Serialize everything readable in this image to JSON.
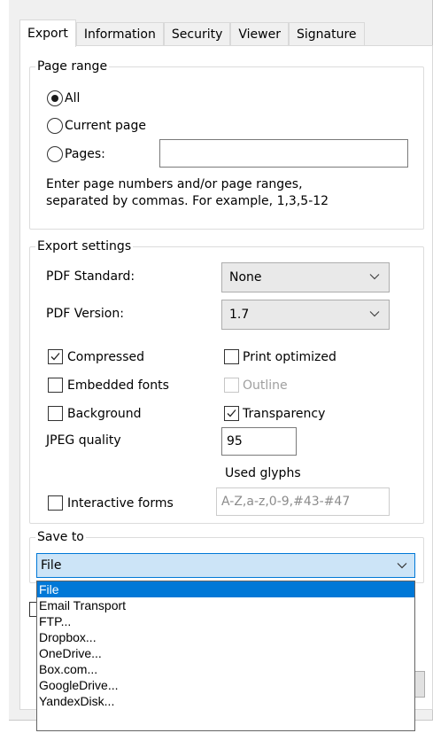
{
  "tabs": [
    "Export",
    "Information",
    "Security",
    "Viewer",
    "Signature"
  ],
  "page_range": {
    "legend": "Page range",
    "all_label": "All",
    "current_label": "Current page",
    "pages_label": "Pages:",
    "pages_value": "",
    "hint_line1": "Enter page numbers and/or page ranges,",
    "hint_line2": "separated by commas. For example, 1,3,5-12",
    "selected": "All"
  },
  "export_settings": {
    "legend": "Export settings",
    "pdf_standard_label": "PDF Standard:",
    "pdf_standard_value": "None",
    "pdf_version_label": "PDF Version:",
    "pdf_version_value": "1.7",
    "compressed_label": "Compressed",
    "compressed_checked": true,
    "print_optimized_label": "Print optimized",
    "print_optimized_checked": false,
    "embedded_fonts_label": "Embedded fonts",
    "embedded_fonts_checked": false,
    "outline_label": "Outline",
    "outline_checked": false,
    "background_label": "Background",
    "background_checked": false,
    "transparency_label": "Transparency",
    "transparency_checked": true,
    "jpeg_quality_label": "JPEG quality",
    "jpeg_quality_value": "95",
    "used_glyphs_label": "Used glyphs",
    "used_glyphs_value": "A-Z,a-z,0-9,#43-#47",
    "interactive_forms_label": "Interactive forms",
    "interactive_forms_checked": false
  },
  "save_to": {
    "legend": "Save to",
    "value": "File",
    "options": [
      "File",
      "Email Transport",
      "FTP...",
      "Dropbox...",
      "OneDrive...",
      "Box.com...",
      "GoogleDrive...",
      "YandexDisk..."
    ],
    "selected_index": 0
  },
  "icons": {
    "dropdown": "chevron-down-icon",
    "check": "checkmark-icon"
  },
  "colors": {
    "accent": "#0078d7",
    "selection_bg": "#cce4f7"
  }
}
